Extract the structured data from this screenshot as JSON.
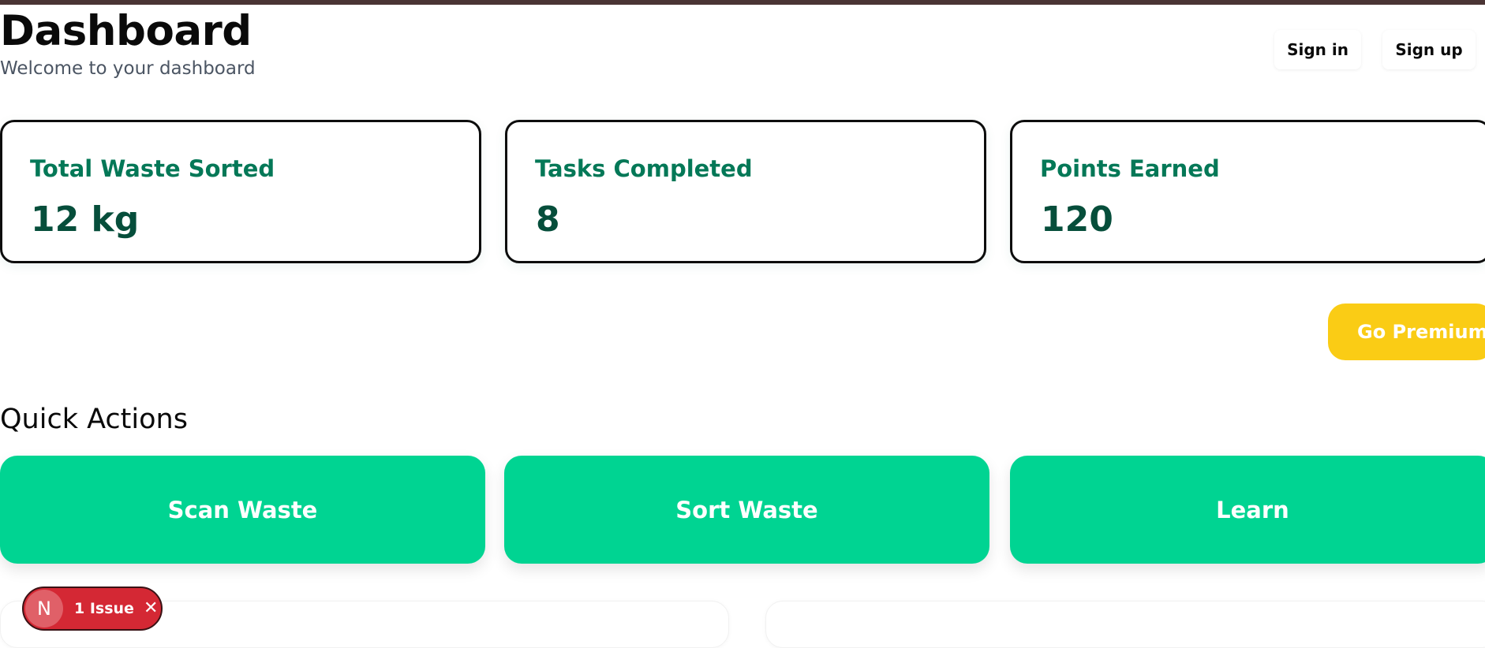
{
  "header": {
    "title": "Dashboard",
    "subtitle": "Welcome to your dashboard",
    "sign_in_label": "Sign in",
    "sign_up_label": "Sign up"
  },
  "stats": [
    {
      "label": "Total Waste Sorted",
      "value": "12 kg"
    },
    {
      "label": "Tasks Completed",
      "value": "8"
    },
    {
      "label": "Points Earned",
      "value": "120"
    }
  ],
  "premium_label": "Go Premium",
  "quick_actions": {
    "title": "Quick Actions",
    "items": [
      {
        "label": "Scan Waste"
      },
      {
        "label": "Sort Waste"
      },
      {
        "label": "Learn"
      }
    ]
  },
  "issue_badge": {
    "logo_letter": "N",
    "label": "1 Issue",
    "close_icon": "close-icon"
  },
  "colors": {
    "top_bar": "#4a3434",
    "stat_label": "#047857",
    "stat_value": "#064e3b",
    "premium": "#facc15",
    "action": "#00d492",
    "issue_badge": "#d42834"
  }
}
